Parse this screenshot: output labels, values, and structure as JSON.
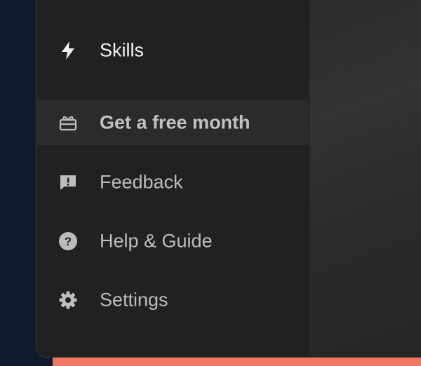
{
  "menu": {
    "items": [
      {
        "label": "Skills",
        "icon": "lightning-bolt-icon"
      },
      {
        "label": "Get a free month",
        "icon": "gift-icon"
      },
      {
        "label": "Feedback",
        "icon": "feedback-icon"
      },
      {
        "label": "Help & Guide",
        "icon": "help-icon"
      },
      {
        "label": "Settings",
        "icon": "gear-icon"
      }
    ]
  },
  "colors": {
    "panel_background": "#212121",
    "highlight_background": "#2b2b2b",
    "page_background": "#101a2e",
    "accent": "#f07860",
    "icon": "#bdbdbd",
    "active_text": "#f2f2f2"
  }
}
